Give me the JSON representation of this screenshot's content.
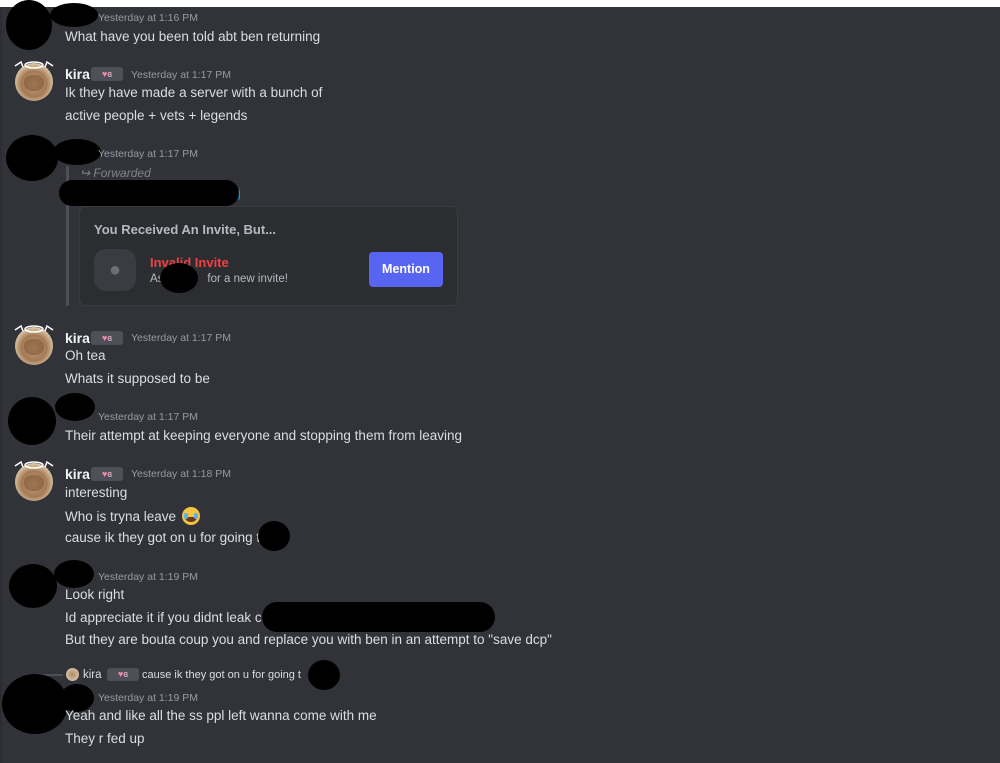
{
  "messages": [
    {
      "timestamp": "Yesterday at 1:16 PM",
      "lines": [
        "What have you been told abt ben returning"
      ]
    },
    {
      "author": "kira",
      "tag": "ɞ",
      "timestamp": "Yesterday at 1:17 PM",
      "lines": [
        "Ik they have made a server with a bunch of",
        "active people + vets + legends"
      ]
    },
    {
      "timestamp": "Yesterday at 1:17 PM",
      "forwarded_label": "Forwarded",
      "invite": {
        "title": "You Received An Invite, But...",
        "status": "Invalid Invite",
        "hint_prefix": "As",
        "hint_suffix": "for a new invite!",
        "button": "Mention"
      }
    },
    {
      "author": "kira",
      "tag": "ɞ",
      "timestamp": "Yesterday at 1:17 PM",
      "lines": [
        "Oh tea",
        "Whats it supposed to be"
      ]
    },
    {
      "timestamp": "Yesterday at 1:17 PM",
      "lines": [
        "Their attempt at keeping everyone and stopping them from leaving"
      ]
    },
    {
      "author": "kira",
      "tag": "ɞ",
      "timestamp": "Yesterday at 1:18 PM",
      "lines": [
        "interesting",
        "Who is tryna leave",
        "cause ik they got on u for going to"
      ]
    },
    {
      "timestamp": "Yesterday at 1:19 PM",
      "lines": [
        "Look right",
        "Id appreciate it if you didnt leak cu",
        "But they are bouta coup you and replace you with ben in an attempt to \"save dcp\""
      ]
    },
    {
      "timestamp": "Yesterday at 1:19 PM",
      "reply": {
        "author": "kira",
        "tag": "ɞ",
        "text": "cause ik they got on u for going t"
      },
      "lines": [
        "Yeah and like all the ss ppl left wanna come with me",
        "They r fed up"
      ]
    }
  ],
  "icons": {
    "emoji": "loudly-crying-face",
    "forward": "forward-arrow",
    "guild": "poop-placeholder"
  }
}
